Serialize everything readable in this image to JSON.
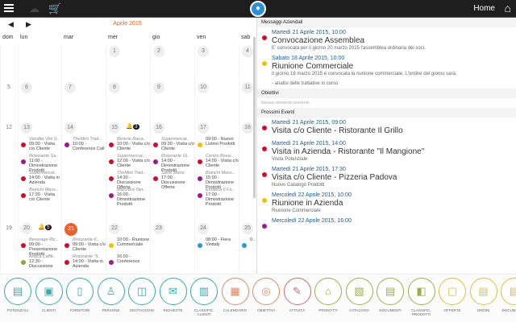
{
  "topbar": {
    "home_label": "Home",
    "icons": [
      "menu-icon",
      "cloud-sync-icon",
      "cart-icon",
      "app-logo",
      "home-icon"
    ]
  },
  "calendar": {
    "month": "Aprile 2015",
    "prev": "◀",
    "next": "▶",
    "weekdays": [
      "dom",
      "lun",
      "mar",
      "mer",
      "gio",
      "ven",
      "sab"
    ],
    "rows": [
      {
        "days": [
          "",
          "",
          "",
          "1",
          "2",
          "3",
          "4"
        ]
      },
      {
        "days": [
          "5",
          "6",
          "7",
          "8",
          "9",
          "10",
          "11"
        ]
      },
      {
        "days": [
          "12",
          "13",
          "14",
          "15",
          "16",
          "17",
          "18"
        ]
      },
      {
        "days": [
          "19",
          "20",
          "21",
          "22",
          "23",
          "24",
          "25"
        ]
      }
    ],
    "badges": {
      "15": "3",
      "20": "5"
    },
    "today": "21",
    "events": {
      "13": [
        {
          "c": "Vendita Vini S..",
          "t": "09:00 - Visita c/o Cliente",
          "col": "#c8102e"
        },
        {
          "c": "Ristorante Sa..",
          "t": "11:00 - Dimostrazione Prodotti",
          "col": "#9c1a8c"
        },
        {
          "c": "Supermercat..",
          "t": "14:00 - Visita in Azienda",
          "col": "#c8102e"
        },
        {
          "c": "Bianchi Mass..",
          "t": "17:30 - Visita c/o Cliente",
          "col": "#c8102e"
        }
      ],
      "14": [
        {
          "c": "TheMint Trad..",
          "t": "10:00 - Conference Call",
          "col": "#9c1a8c"
        }
      ],
      "15": [
        {
          "c": "Birreria Barra..",
          "t": "10:00 - Visita c/o Cliente",
          "col": "#c8102e"
        },
        {
          "c": "Supermercat..",
          "t": "12:00 - Visita c/o Cliente",
          "col": "#c8102e"
        },
        {
          "c": "TheMint Trad..",
          "t": "14:30 - Discussione Offerta",
          "col": "#c8102e"
        },
        {
          "c": "Marchesi Ner..",
          "t": "16:00 - Dimostrazione Prodotti",
          "col": "#9c1a8c"
        }
      ],
      "16": [
        {
          "c": "Supermercat..",
          "t": "09:30 - Visita c/o Cliente",
          "col": "#c8102e"
        },
        {
          "c": "Ristorante Gi..",
          "t": "14:00 - Dimostrazione Prodotti",
          "col": "#9c1a8c"
        },
        {
          "c": "Sassi Mario",
          "t": "17:00 - Discussione Offerta",
          "col": "#c8102e"
        }
      ],
      "17": [
        {
          "c": "",
          "t": "09:00 - Nuovo Listino Prodotti",
          "col": "#f2c200"
        },
        {
          "c": "Centro Bessi..",
          "t": "14:00 - Visita c/o Cliente",
          "col": "#c8102e"
        },
        {
          "c": "Bianchi Mass..",
          "t": "15:00 - Dimostrazione Prodotti",
          "col": "#9c1a8c"
        },
        {
          "c": "Enoteca Il Fu..",
          "t": "17:00 - Dimostrazione Prodotti",
          "col": "#9c1a8c"
        }
      ],
      "20": [
        {
          "c": "Beverage Ric..",
          "t": "09:00 - Presentazione Prodotti",
          "col": "#c8102e"
        },
        {
          "c": "Antica Caffè..",
          "t": "12:30 - Discussione",
          "col": "#8aa83a"
        }
      ],
      "21": [
        {
          "c": "Ristorante Il..",
          "t": "09:00 - Visita c/o Cliente",
          "col": "#c8102e"
        },
        {
          "c": "Ristorante \"Il..",
          "t": "14:00 - Visita in Azienda",
          "col": "#c8102e"
        }
      ],
      "22": [
        {
          "c": "",
          "t": "10:00 - Riunione Commerciale",
          "col": "#f2c200"
        },
        {
          "c": "",
          "t": "16:00 - Conference",
          "col": "#9c1a8c"
        }
      ],
      "24": [
        {
          "c": "",
          "t": "08:00 - Fiera Vinitaly",
          "col": "#2a9bc8"
        }
      ],
      "25": [
        {
          "c": "",
          "t": "0...",
          "col": "#2a9bc8"
        }
      ]
    }
  },
  "messages": {
    "title": "Messaggi Aziendali",
    "items": [
      {
        "date": "Martedì 21 Aprile 2015, 10:00",
        "title": "Convocazione Assemblea",
        "desc": "E' convocata per il giorno 20 marzo 2015 l'assemblea ordinaria dei soci.",
        "color": "#c8102e"
      },
      {
        "date": "Sabato 18 Aprile 2015, 10:00",
        "title": "Riunione Commerciale",
        "desc": "Il giorno 18 marzo 2015 è convocata la riunione commerciale. L'ordine del giorno sarà:",
        "desc2": "- analisi delle trattative in corso",
        "color": "#f2c200"
      }
    ]
  },
  "objectives": {
    "title": "Obiettivi",
    "empty": "Nessun elemento presente."
  },
  "events": {
    "title": "Prossimi Eventi",
    "items": [
      {
        "date": "Martedì 21 Aprile 2015, 09:00",
        "title": "Visita c/o Cliente - Ristorante Il Grillo",
        "desc": "",
        "color": "#c8102e"
      },
      {
        "date": "Martedì 21 Aprile 2015, 14:00",
        "title": "Visita in Azienda - Ristorante \"Il Mangione\"",
        "desc": "Visita Potenziale",
        "color": "#c8102e"
      },
      {
        "date": "Martedì 21 Aprile 2015, 17:30",
        "title": "Visita c/o Cliente - Pizzeria Padova",
        "desc": "Nuovo Catalogo Prodotti",
        "color": "#c8102e"
      },
      {
        "date": "Mercoledì 22 Aprile 2015, 10:00",
        "title": "Riunione in Azienda",
        "desc": "Riunione Commerciale",
        "color": "#f2c200"
      },
      {
        "date": "Mercoledì 22 Aprile 2015, 16:00",
        "title": "",
        "desc": "",
        "color": "#9c1a8c"
      }
    ]
  },
  "toolbar": [
    {
      "label": "POTENZIALI",
      "icon": "▤",
      "color": "#3aa8a8"
    },
    {
      "label": "CLIENTI",
      "icon": "▣",
      "color": "#3aa8a8"
    },
    {
      "label": "FORNITORI",
      "icon": "▯",
      "color": "#3aa8a8"
    },
    {
      "label": "PERSONE",
      "icon": "♙",
      "color": "#3aa8a8"
    },
    {
      "label": "GEOTAGGING",
      "icon": "◫",
      "color": "#3aa8a8"
    },
    {
      "label": "RICHIESTE",
      "icon": "✉",
      "color": "#3aa8a8"
    },
    {
      "label": "CLASSIFIC. CLIENTI",
      "icon": "▥",
      "color": "#3aa8a8"
    },
    {
      "label": "CALENDARIO",
      "icon": "▦",
      "color": "#d98a6a"
    },
    {
      "label": "OBIETTIVI",
      "icon": "◎",
      "color": "#d98a6a"
    },
    {
      "label": "ATTIVITÀ",
      "icon": "✎",
      "color": "#c86a6a"
    },
    {
      "label": "PRODOTTI",
      "icon": "⌂",
      "color": "#9ab04a"
    },
    {
      "label": "CATALOGO",
      "icon": "▧",
      "color": "#9ab04a"
    },
    {
      "label": "DOCUMENTI",
      "icon": "▤",
      "color": "#9ab04a"
    },
    {
      "label": "CLASSIFIC. PRODOTTI",
      "icon": "◧",
      "color": "#9ab04a"
    },
    {
      "label": "OFFERTE",
      "icon": "▢",
      "color": "#d8c040"
    },
    {
      "label": "ORDINI",
      "icon": "▤",
      "color": "#d8c040"
    },
    {
      "label": "DOCUM. FISC.",
      "icon": "▤",
      "color": "#d8c040"
    }
  ]
}
